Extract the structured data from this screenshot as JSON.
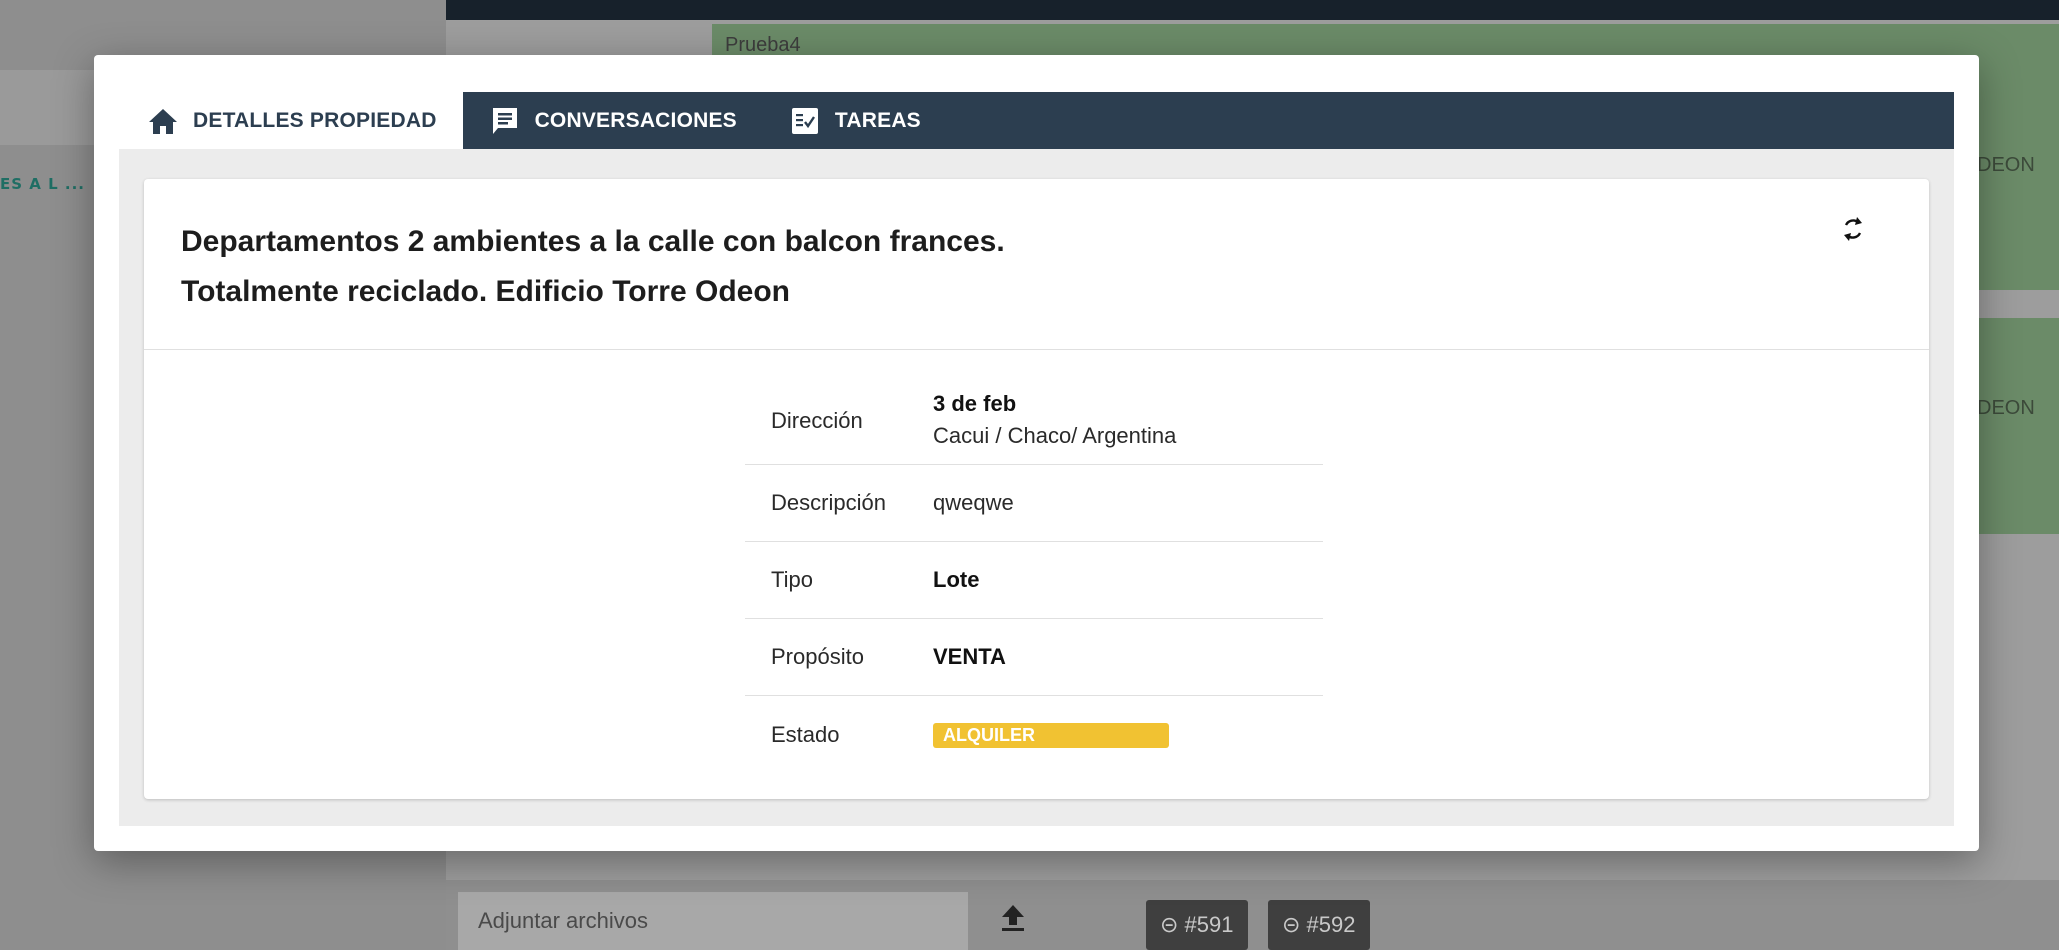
{
  "background": {
    "card_title": "Prueba4",
    "card_suffix_1": "DEON",
    "card_suffix_2": "DEON",
    "left_snippet": "ES A L ...",
    "attach_placeholder": "Adjuntar archivos",
    "chips": [
      "#591",
      "#592"
    ]
  },
  "tabs": [
    {
      "label": "DETALLES PROPIEDAD",
      "icon": "home-icon",
      "active": true
    },
    {
      "label": "CONVERSACIONES",
      "icon": "chat-icon",
      "active": false
    },
    {
      "label": "TAREAS",
      "icon": "task-list-icon",
      "active": false
    }
  ],
  "property": {
    "title_line1": "Departamentos 2 ambientes a la calle con balcon frances.",
    "title_line2": "Totalmente reciclado. Edificio Torre Odeon",
    "refresh_icon": "refresh-icon",
    "fields": {
      "direccion_label": "Dirección",
      "direccion_street": "3 de feb",
      "direccion_location": "Cacui / Chaco/ Argentina",
      "descripcion_label": "Descripción",
      "descripcion_value": "qweqwe",
      "tipo_label": "Tipo",
      "tipo_value": "Lote",
      "proposito_label": "Propósito",
      "proposito_value": "VENTA",
      "estado_label": "Estado",
      "estado_value": "ALQUILER"
    }
  },
  "colors": {
    "tabbar": "#2c3e50",
    "estado_badge": "#f1c232",
    "card_background": "#6b8b68"
  }
}
